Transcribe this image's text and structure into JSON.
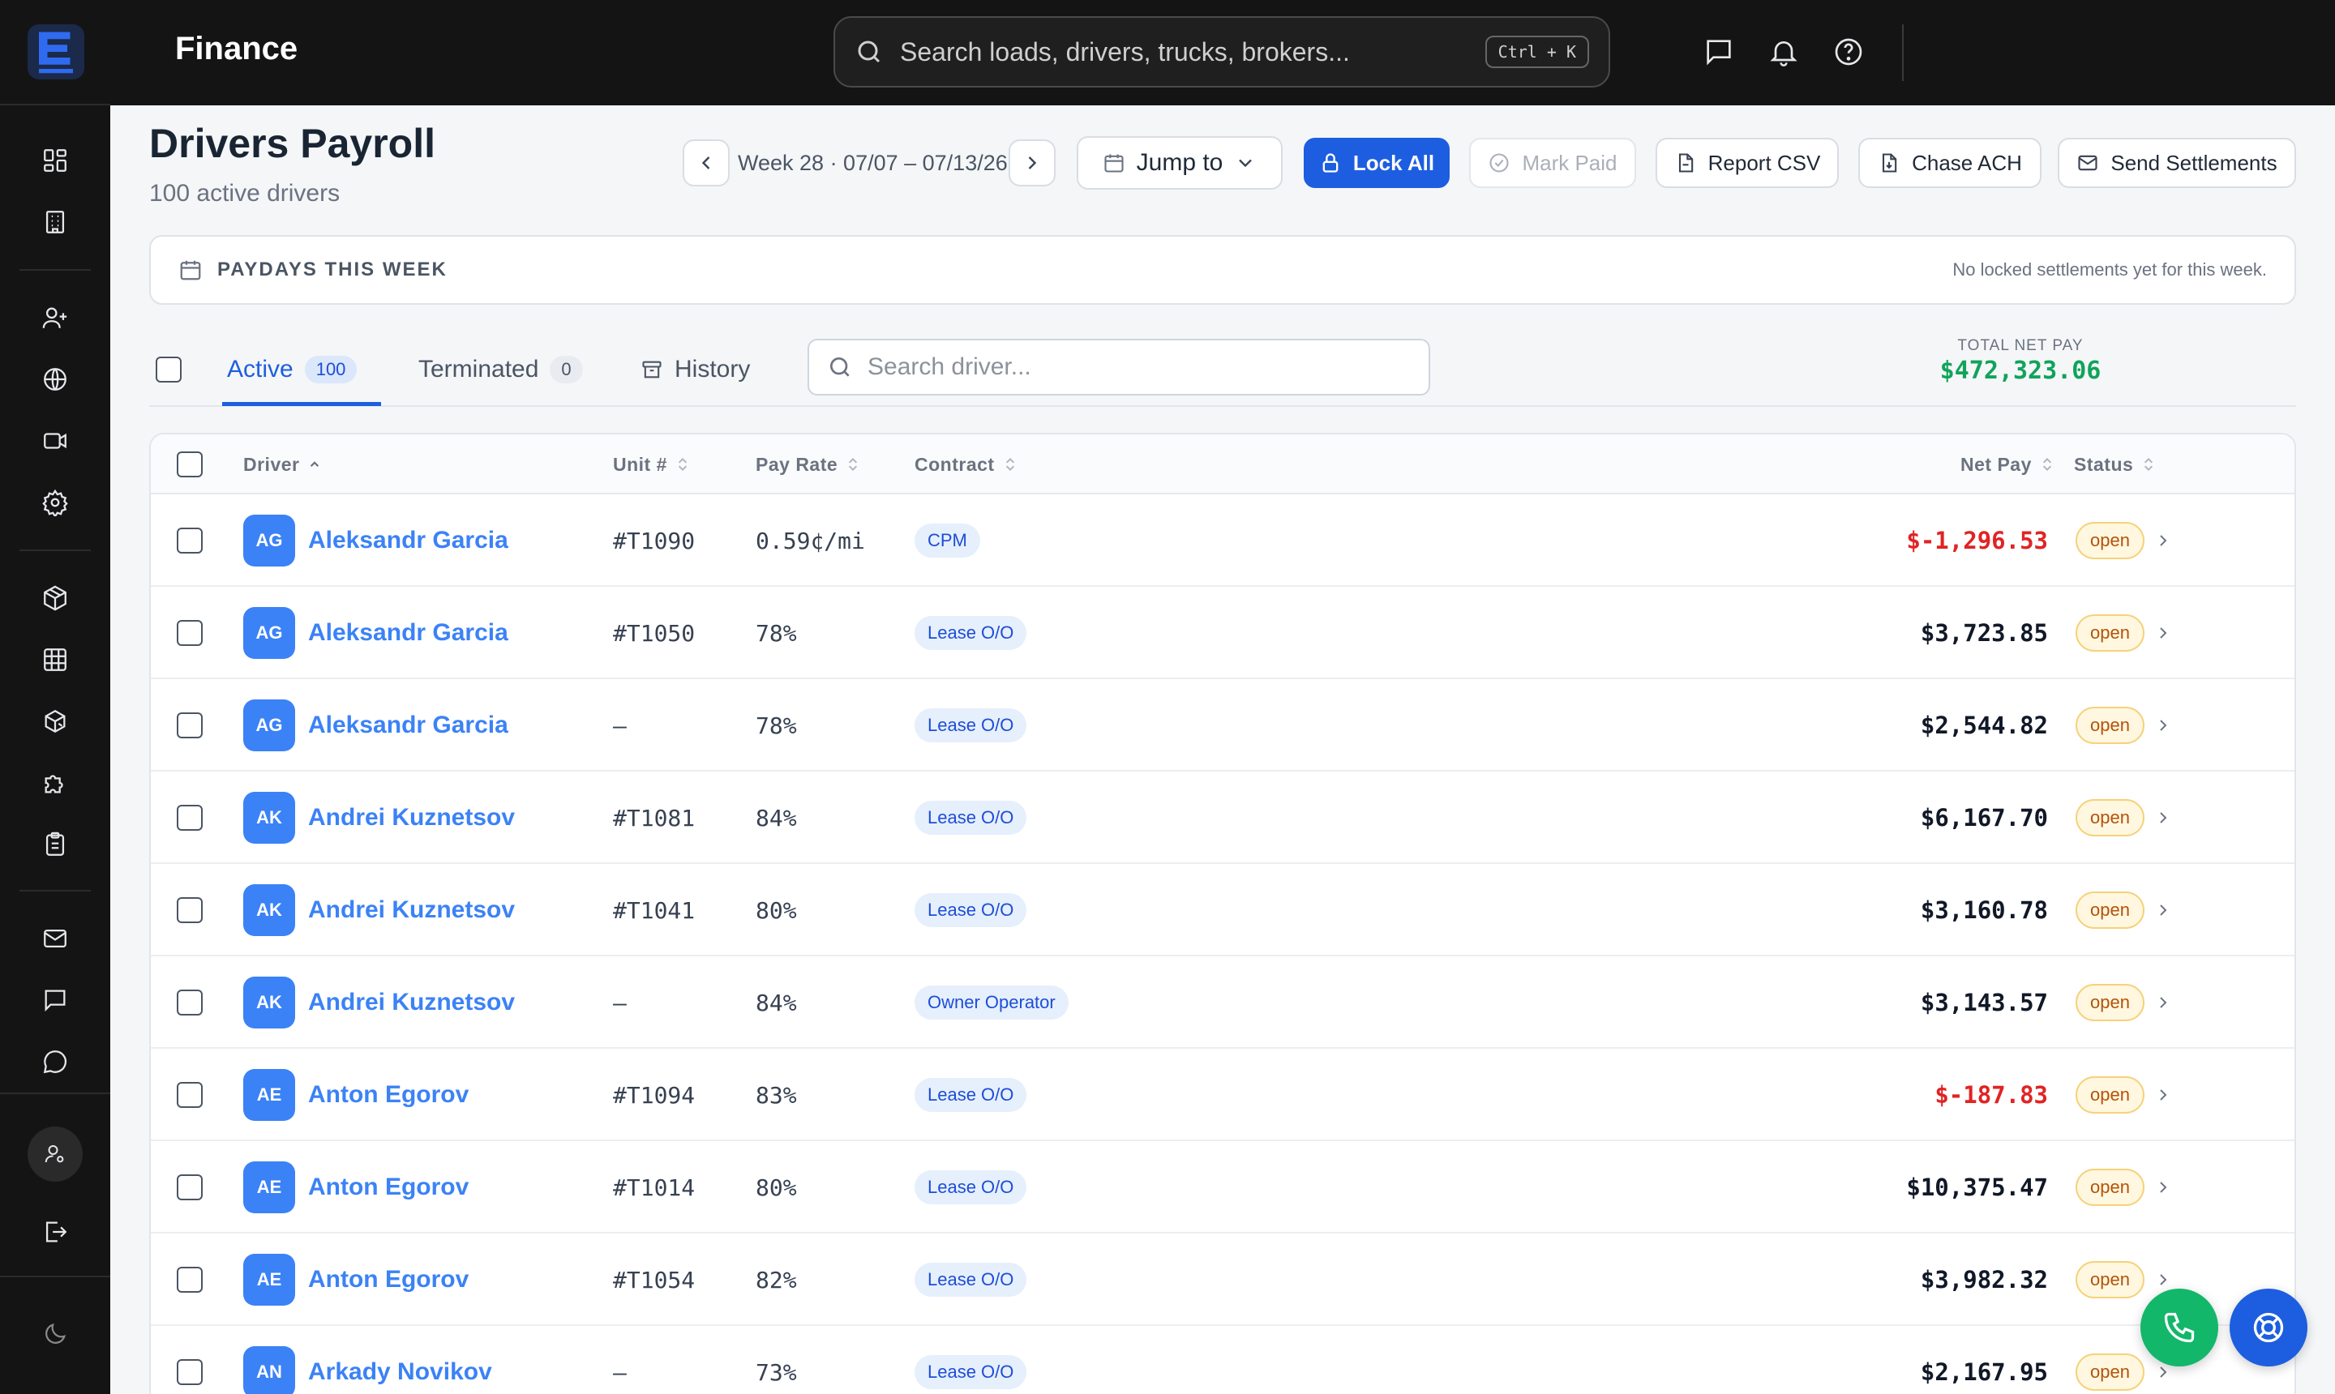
{
  "app": {
    "title": "Finance"
  },
  "global_search": {
    "placeholder": "Search loads, drivers, trucks, brokers...",
    "shortcut": "Ctrl + K"
  },
  "header": {
    "title": "Drivers Payroll",
    "subtitle": "100 active drivers",
    "week_label": "Week 28 · 07/07 – 07/13/26",
    "jump_label": "Jump to",
    "lock_all_label": "Lock All",
    "mark_paid_label": "Mark Paid",
    "report_csv_label": "Report CSV",
    "chase_ach_label": "Chase ACH",
    "send_settlements_label": "Send Settlements"
  },
  "paydays": {
    "title": "PAYDAYS THIS WEEK",
    "note": "No locked settlements yet for this week."
  },
  "tabs": [
    {
      "label": "Active",
      "count": "100"
    },
    {
      "label": "Terminated",
      "count": "0"
    },
    {
      "label": "History"
    }
  ],
  "driver_search": {
    "placeholder": "Search driver..."
  },
  "total": {
    "label": "TOTAL NET PAY",
    "value": "$472,323.06"
  },
  "table": {
    "columns": {
      "driver": "Driver",
      "unit": "Unit #",
      "pay_rate": "Pay Rate",
      "contract": "Contract",
      "net_pay": "Net Pay",
      "status": "Status"
    },
    "rows": [
      {
        "initials": "AG",
        "name": "Aleksandr Garcia",
        "unit": "#T1090",
        "rate": "0.59¢/mi",
        "contract": "CPM",
        "net": "$-1,296.53",
        "negative": true,
        "status": "open"
      },
      {
        "initials": "AG",
        "name": "Aleksandr Garcia",
        "unit": "#T1050",
        "rate": "78%",
        "contract": "Lease O/O",
        "net": "$3,723.85",
        "negative": false,
        "status": "open"
      },
      {
        "initials": "AG",
        "name": "Aleksandr Garcia",
        "unit": "—",
        "rate": "78%",
        "contract": "Lease O/O",
        "net": "$2,544.82",
        "negative": false,
        "status": "open"
      },
      {
        "initials": "AK",
        "name": "Andrei Kuznetsov",
        "unit": "#T1081",
        "rate": "84%",
        "contract": "Lease O/O",
        "net": "$6,167.70",
        "negative": false,
        "status": "open"
      },
      {
        "initials": "AK",
        "name": "Andrei Kuznetsov",
        "unit": "#T1041",
        "rate": "80%",
        "contract": "Lease O/O",
        "net": "$3,160.78",
        "negative": false,
        "status": "open"
      },
      {
        "initials": "AK",
        "name": "Andrei Kuznetsov",
        "unit": "—",
        "rate": "84%",
        "contract": "Owner Operator",
        "net": "$3,143.57",
        "negative": false,
        "status": "open"
      },
      {
        "initials": "AE",
        "name": "Anton Egorov",
        "unit": "#T1094",
        "rate": "83%",
        "contract": "Lease O/O",
        "net": "$-187.83",
        "negative": true,
        "status": "open"
      },
      {
        "initials": "AE",
        "name": "Anton Egorov",
        "unit": "#T1014",
        "rate": "80%",
        "contract": "Lease O/O",
        "net": "$10,375.47",
        "negative": false,
        "status": "open"
      },
      {
        "initials": "AE",
        "name": "Anton Egorov",
        "unit": "#T1054",
        "rate": "82%",
        "contract": "Lease O/O",
        "net": "$3,982.32",
        "negative": false,
        "status": "open"
      },
      {
        "initials": "AN",
        "name": "Arkady Novikov",
        "unit": "—",
        "rate": "73%",
        "contract": "Lease O/O",
        "net": "$2,167.95",
        "negative": false,
        "status": "open"
      }
    ]
  },
  "colors": {
    "accent": "#1d5ee0",
    "link": "#3b82f6",
    "positive": "#10a35a",
    "negative": "#e02424",
    "fab_call": "#12b76a",
    "fab_help": "#1d5ee0"
  },
  "sidebar_icons": [
    "dashboard-icon",
    "building-icon",
    "user-plus-icon",
    "globe-icon",
    "video-icon",
    "settings-icon",
    "box-icon",
    "grid-icon",
    "boxes-icon",
    "puzzle-icon",
    "clipboard-icon",
    "mail-icon",
    "message-square-icon",
    "message-circle-icon",
    "user-settings-icon",
    "logout-icon",
    "moon-icon"
  ]
}
